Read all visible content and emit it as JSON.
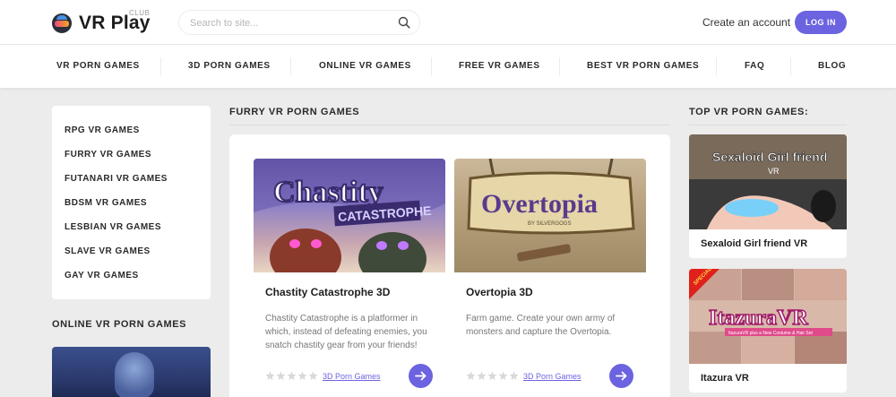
{
  "header": {
    "logo_text": "VR Play",
    "logo_sup": "CLUB",
    "search_placeholder": "Search to site...",
    "create_account": "Create an account",
    "login": "LOG IN",
    "accent_color": "#6c63e0"
  },
  "nav": {
    "items": [
      "VR PORN GAMES",
      "3D PORN GAMES",
      "ONLINE VR GAMES",
      "FREE VR GAMES",
      "BEST VR PORN GAMES",
      "FAQ",
      "BLOG"
    ]
  },
  "sidebar": {
    "categories": [
      "RPG VR GAMES",
      "FURRY VR GAMES",
      "FUTANARI VR GAMES",
      "BDSM VR GAMES",
      "LESBIAN VR GAMES",
      "SLAVE VR GAMES",
      "GAY VR GAMES"
    ],
    "online_title": "ONLINE VR PORN GAMES"
  },
  "main": {
    "title": "FURRY VR PORN GAMES",
    "games": [
      {
        "title": "Chastity Catastrophe 3D",
        "thumb_text": "Chastity",
        "thumb_subtext": "CATASTROPHE",
        "description": "Chastity Catastrophe is a platformer in which, instead of defeating enemies, you snatch chastity gear from your friends!",
        "tag": "3D Porn Games",
        "rating": 0
      },
      {
        "title": "Overtopia 3D",
        "thumb_text": "Overtopia",
        "thumb_subtext": "BY SILVERGOGS",
        "description": "Farm game. Create your own army of monsters and capture the Overtopia.",
        "tag": "3D Porn Games",
        "rating": 0
      }
    ]
  },
  "right": {
    "title": "TOP VR PORN GAMES:",
    "items": [
      {
        "title": "Sexaloid Girl friend VR",
        "thumb_text": "Sexaloid Girl  friend",
        "thumb_subtext": "VR"
      },
      {
        "title": "Itazura VR",
        "thumb_text": "ItazuraVR",
        "thumb_badge": "SPECIAL EDITION",
        "thumb_caption": "ItazuraVR plus a New Costume & Hair Set"
      }
    ]
  }
}
